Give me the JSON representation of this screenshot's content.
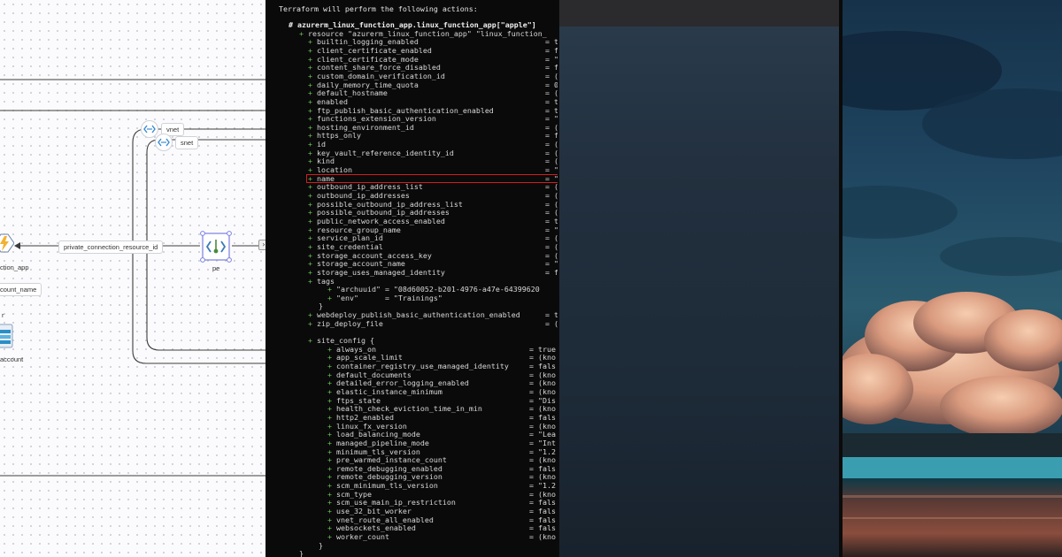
{
  "diagram": {
    "nodes": {
      "function_app_label": "ction_app",
      "account_name_tag": "count_name",
      "storage_label": "account",
      "storage_top_letter": "r",
      "pe_label": "pe",
      "vnet_label": "vnet",
      "snet_label": "snet"
    },
    "edge_label": "private_connection_resource_id",
    "collapse_glyph": "›"
  },
  "terminal": {
    "header": "Terraform will perform the following actions:",
    "resource_comment": "# azurerm_linux_function_app.linux_function_app[\"apple\"]",
    "resource_line": "resource \"azurerm_linux_function_app\" \"linux_function_",
    "attributes": [
      {
        "name": "builtin_logging_enabled",
        "value": "= t"
      },
      {
        "name": "client_certificate_enabled",
        "value": "= f"
      },
      {
        "name": "client_certificate_mode",
        "value": "= \""
      },
      {
        "name": "content_share_force_disabled",
        "value": "= f"
      },
      {
        "name": "custom_domain_verification_id",
        "value": "= ("
      },
      {
        "name": "daily_memory_time_quota",
        "value": "= 0"
      },
      {
        "name": "default_hostname",
        "value": "= ("
      },
      {
        "name": "enabled",
        "value": "= t"
      },
      {
        "name": "ftp_publish_basic_authentication_enabled",
        "value": "= t"
      },
      {
        "name": "functions_extension_version",
        "value": "= \""
      },
      {
        "name": "hosting_environment_id",
        "value": "= ("
      },
      {
        "name": "https_only",
        "value": "= f"
      },
      {
        "name": "id",
        "value": "= ("
      },
      {
        "name": "key_vault_reference_identity_id",
        "value": "= ("
      },
      {
        "name": "kind",
        "value": "= ("
      },
      {
        "name": "location",
        "value": "= \""
      },
      {
        "name": "name",
        "value": "= \""
      },
      {
        "name": "outbound_ip_address_list",
        "value": "= ("
      },
      {
        "name": "outbound_ip_addresses",
        "value": "= ("
      },
      {
        "name": "possible_outbound_ip_address_list",
        "value": "= ("
      },
      {
        "name": "possible_outbound_ip_addresses",
        "value": "= ("
      },
      {
        "name": "public_network_access_enabled",
        "value": "= t"
      },
      {
        "name": "resource_group_name",
        "value": "= \""
      },
      {
        "name": "service_plan_id",
        "value": "= ("
      },
      {
        "name": "site_credential",
        "value": "= ("
      },
      {
        "name": "storage_account_access_key",
        "value": "= ("
      },
      {
        "name": "storage_account_name",
        "value": "= \""
      },
      {
        "name": "storage_uses_managed_identity",
        "value": "= f"
      }
    ],
    "tags_label": "tags",
    "tags": [
      {
        "text": "\"archuuid\" = \"08d60052-b201-4976-a47e-64399620"
      },
      {
        "text": "\"env\"      = \"Trainings\""
      }
    ],
    "close_brace": "}",
    "tail_attributes": [
      {
        "name": "webdeploy_publish_basic_authentication_enabled",
        "value": "= t"
      },
      {
        "name": "zip_deploy_file",
        "value": "= ("
      }
    ],
    "site_config_label": "site_config {",
    "site_config": [
      {
        "name": "always_on",
        "value": "= true"
      },
      {
        "name": "app_scale_limit",
        "value": "= (kno"
      },
      {
        "name": "container_registry_use_managed_identity",
        "value": "= fals"
      },
      {
        "name": "default_documents",
        "value": "= (kno"
      },
      {
        "name": "detailed_error_logging_enabled",
        "value": "= (kno"
      },
      {
        "name": "elastic_instance_minimum",
        "value": "= (kno"
      },
      {
        "name": "ftps_state",
        "value": "= \"Dis"
      },
      {
        "name": "health_check_eviction_time_in_min",
        "value": "= (kno"
      },
      {
        "name": "http2_enabled",
        "value": "= fals"
      },
      {
        "name": "linux_fx_version",
        "value": "= (kno"
      },
      {
        "name": "load_balancing_mode",
        "value": "= \"Lea"
      },
      {
        "name": "managed_pipeline_mode",
        "value": "= \"Int"
      },
      {
        "name": "minimum_tls_version",
        "value": "= \"1.2"
      },
      {
        "name": "pre_warmed_instance_count",
        "value": "= (kno"
      },
      {
        "name": "remote_debugging_enabled",
        "value": "= fals"
      },
      {
        "name": "remote_debugging_version",
        "value": "= (kno"
      },
      {
        "name": "scm_minimum_tls_version",
        "value": "= \"1.2"
      },
      {
        "name": "scm_type",
        "value": "= (kno"
      },
      {
        "name": "scm_use_main_ip_restriction",
        "value": "= fals"
      },
      {
        "name": "use_32_bit_worker",
        "value": "= fals"
      },
      {
        "name": "vnet_route_all_enabled",
        "value": "= fals"
      },
      {
        "name": "websockets_enabled",
        "value": "= fals"
      },
      {
        "name": "worker_count",
        "value": "= (kno"
      }
    ],
    "end_braces": [
      "}",
      "}"
    ],
    "highlighted_attribute": "name"
  },
  "colors": {
    "diagram_bg": "#fbfbfd",
    "terminal_bg": "#0a0a0a",
    "terminal_plus": "#6bbf59",
    "highlight_box": "#d11e1e",
    "panel3_bg": "#22303f",
    "sky_top": "#1f3a4c"
  },
  "icons": {
    "function_app": "lightning-bolt-icon",
    "storage": "storage-account-icon",
    "pe": "private-endpoint-icon",
    "vnet": "virtual-network-icon",
    "snet": "subnet-icon"
  }
}
